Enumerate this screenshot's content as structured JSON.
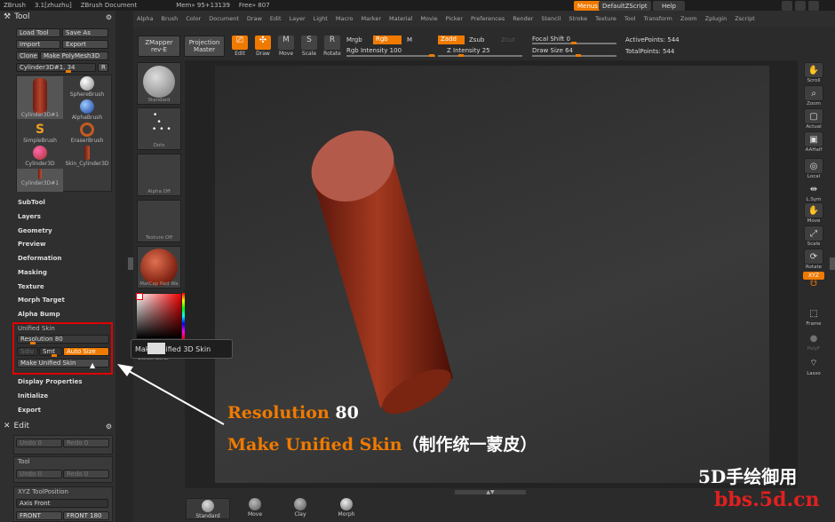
{
  "titlebar": {
    "app": "ZBrush",
    "version": "3.1[zhuzhu]",
    "document": "ZBrush Document",
    "mem": "Mem» 95+13139",
    "free": "Free» 807",
    "menus_btn": "Menus",
    "script_btn": "DefaultZScript",
    "help_btn": "Help"
  },
  "menubar": {
    "items": [
      "Alpha",
      "Brush",
      "Color",
      "Document",
      "Draw",
      "Edit",
      "Layer",
      "Light",
      "Macro",
      "Marker",
      "Material",
      "Movie",
      "Picker",
      "Preferences",
      "Render",
      "Stencil",
      "Stroke",
      "Texture",
      "Tool",
      "Transform",
      "Zoom",
      "Zplugin",
      "Zscript"
    ]
  },
  "tool_panel": {
    "title": "Tool",
    "load_tool": "Load Tool",
    "save_as": "Save As",
    "import": "Import",
    "export": "Export",
    "clone": "Clone",
    "make_polymesh": "Make PolyMesh3D",
    "current_tool": "Cylinder3D#1. 34",
    "r_btn": "R",
    "brushes": [
      {
        "label": "Cylinder3D#1"
      },
      {
        "label": "SphereBrush"
      },
      {
        "label": "AlphaBrush"
      },
      {
        "label": "SimpleBrush"
      },
      {
        "label": "EraserBrush"
      },
      {
        "label": "Cylinder3D"
      },
      {
        "label": "Skin_Cylinder3D"
      },
      {
        "label": "Cylinder3D#1"
      }
    ],
    "sections": [
      "SubTool",
      "Layers",
      "Geometry",
      "Preview",
      "Deformation",
      "Masking",
      "Texture",
      "Morph Target",
      "Alpha Bump"
    ],
    "unified_skin": {
      "header": "Unified Skin",
      "resolution_label": "Resolution",
      "resolution_value": "80",
      "sdiv": "Sdiv",
      "smt": "Smt",
      "auto_size": "Auto Size",
      "make_unified_skin": "Make Unified Skin"
    },
    "sections_after": [
      "Display Properties",
      "Initialize",
      "Export"
    ]
  },
  "edit_panel": {
    "title": "Edit",
    "undo": "Undo 0",
    "redo": "Redo 0",
    "tool_label": "Tool",
    "undo2": "Undo 0",
    "redo2": "Redo 0"
  },
  "xyz_panel": {
    "title": "XYZ ToolPosition",
    "axis": "Axis Front",
    "front": "FRONT",
    "front_value": "FRONT 180"
  },
  "top_tools": {
    "zmapper": "ZMapper",
    "zmapper_sub": "rev-E",
    "projection": "Projection",
    "projection_sub": "Master",
    "edit": "Edit",
    "draw": "Draw",
    "move": "Move",
    "scale": "Scale",
    "rotate": "Rotate",
    "mrgb": "Mrgb",
    "rgb": "Rgb",
    "m": "M",
    "rgb_intensity": "Rgb Intensity 100",
    "zadd": "Zadd",
    "zsub": "Zsub",
    "zcut": "Zcut",
    "z_intensity": "Z Intensity 25",
    "focal_shift": "Focal Shift 0",
    "draw_size": "Draw Size 64",
    "active_points": "ActivePoints: 544",
    "total_points": "TotalPoints: 544"
  },
  "left_tiles": [
    {
      "label": "Standard"
    },
    {
      "label": "Dots"
    },
    {
      "label": "Alpha Off"
    },
    {
      "label": "Texture Off"
    },
    {
      "label": "MatCap Red Wa"
    }
  ],
  "switch_color": "SwitchColor",
  "tooltip": "Make Unified 3D Skin",
  "right_shelf": [
    {
      "label": "Scroll",
      "icon": "hand-icon"
    },
    {
      "label": "Zoom",
      "icon": "zoom-icon"
    },
    {
      "label": "Actual",
      "icon": "actual-icon"
    },
    {
      "label": "AAHalf",
      "icon": "aahalf-icon"
    },
    {
      "label": "Local",
      "icon": "local-icon"
    },
    {
      "label": "L.Sym",
      "icon": "lsym-icon"
    },
    {
      "label": "Move",
      "icon": "move-icon"
    },
    {
      "label": "Scale",
      "icon": "scale-icon"
    },
    {
      "label": "Rotate",
      "icon": "rotate-icon"
    },
    {
      "label": "XYZ",
      "icon": "xyz-icon"
    },
    {
      "label": "Frame",
      "icon": "frame-icon"
    },
    {
      "label": "PolyF",
      "icon": "polyf-icon"
    },
    {
      "label": "Lasso",
      "icon": "lasso-icon"
    }
  ],
  "bottom_brushes": [
    {
      "label": "Standard"
    },
    {
      "label": "Move"
    },
    {
      "label": "Clay"
    },
    {
      "label": "Morph"
    }
  ],
  "annotation": {
    "line1_label": "Resolution",
    "line1_value": "80",
    "line2_label": "Make Unified Skin",
    "line2_cn": "（制作统一蒙皮）",
    "accent_color": "#f07a00"
  },
  "watermark": {
    "line1": "5D手绘御用",
    "line2": "bbs.5d.cn"
  }
}
